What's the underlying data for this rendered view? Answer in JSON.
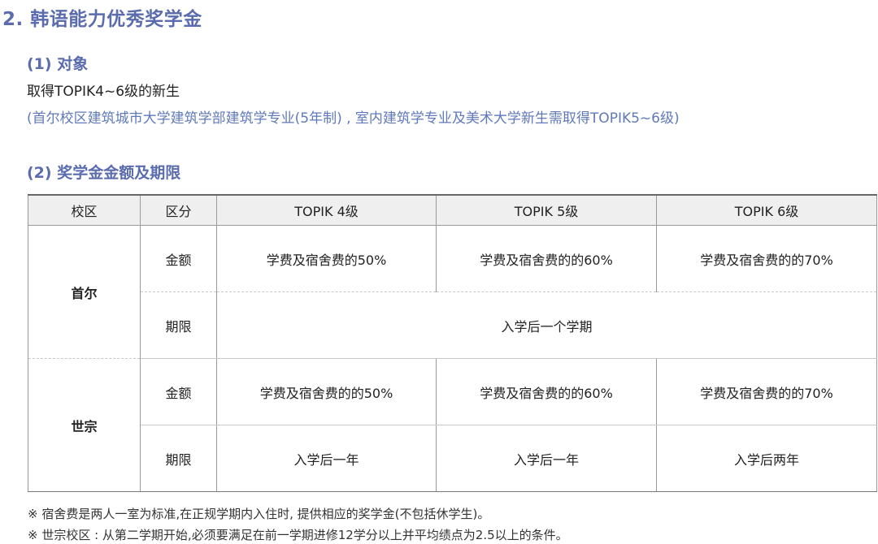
{
  "section_title": "2. 韩语能力优秀奖学金",
  "target": {
    "heading": "(1) 对象",
    "line1": "取得TOPIK4~6级的新生",
    "line2": "(首尔校区建筑城市大学建筑学部建筑学专业(5年制) , 室内建筑学专业及美术大学新生需取得TOPIK5~6级)"
  },
  "amount_heading": "(2) 奖学金金额及期限",
  "table": {
    "headers": [
      "校区",
      "区分",
      "TOPIK 4级",
      "TOPIK 5级",
      "TOPIK 6级"
    ],
    "seoul": {
      "campus": "首尔",
      "amount_label": "金额",
      "amounts": [
        "学费及宿舍费的50%",
        "学费及宿舍费的的60%",
        "学费及宿舍费的的70%"
      ],
      "period_label": "期限",
      "period": "入学后一个学期"
    },
    "sejong": {
      "campus": "世宗",
      "amount_label": "金额",
      "amounts": [
        "学费及宿舍费的的50%",
        "学费及宿舍费的的60%",
        "学费及宿舍费的的70%"
      ],
      "period_label": "期限",
      "periods": [
        "入学后一年",
        "入学后一年",
        "入学后两年"
      ]
    }
  },
  "notes": [
    "※ 宿舍费是两人一室为标准,在正规学期内入住时, 提供相应的奖学金(不包括休学生)。",
    "※ 世宗校区 : 从第二学期开始,必须要满足在前一学期进修12学分以上并平均绩点为2.5以上的条件。"
  ]
}
